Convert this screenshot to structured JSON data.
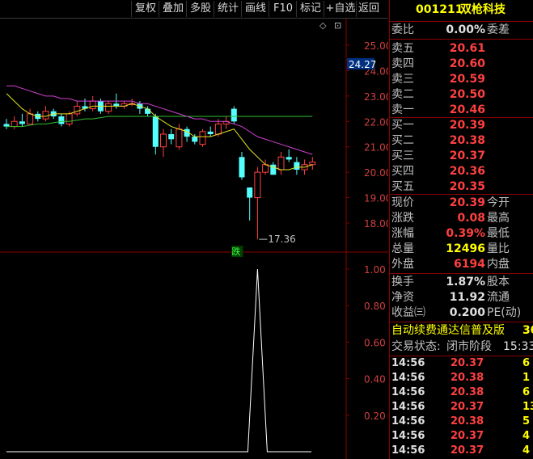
{
  "toolbar": {
    "buttons": [
      "复权",
      "叠加",
      "多股",
      "统计",
      "画线",
      "F10",
      "标记",
      "+自选",
      "返回"
    ]
  },
  "chart": {
    "price_axis_labels": [
      "25.00",
      "24.00",
      "23.00",
      "22.00",
      "21.00",
      "20.00",
      "19.00",
      "18.00"
    ],
    "current_price_tag": "24.27",
    "low_marker": "17.36",
    "drop_marker": "跌",
    "indicator_axis_labels": [
      "1.00",
      "0.80",
      "0.60",
      "0.40",
      "0.20"
    ],
    "settings_glyph": "◇",
    "collapse_glyph": "⊡"
  },
  "chart_data": {
    "type": "candlestick",
    "price_ylim": [
      17.0,
      25.5
    ],
    "candles": [
      {
        "o": 21.9,
        "h": 22.1,
        "l": 21.7,
        "c": 21.8,
        "up": false
      },
      {
        "o": 21.8,
        "h": 22.2,
        "l": 21.7,
        "c": 22.0,
        "up": true
      },
      {
        "o": 22.0,
        "h": 22.3,
        "l": 21.8,
        "c": 21.9,
        "up": false
      },
      {
        "o": 21.9,
        "h": 22.5,
        "l": 21.9,
        "c": 22.3,
        "up": true
      },
      {
        "o": 22.3,
        "h": 22.4,
        "l": 22.0,
        "c": 22.1,
        "up": false
      },
      {
        "o": 22.1,
        "h": 22.6,
        "l": 22.0,
        "c": 22.4,
        "up": true
      },
      {
        "o": 22.4,
        "h": 22.5,
        "l": 22.1,
        "c": 22.2,
        "up": false
      },
      {
        "o": 22.2,
        "h": 22.3,
        "l": 21.8,
        "c": 21.9,
        "up": false
      },
      {
        "o": 21.9,
        "h": 22.4,
        "l": 21.8,
        "c": 22.3,
        "up": true
      },
      {
        "o": 22.3,
        "h": 22.8,
        "l": 22.2,
        "c": 22.6,
        "up": true
      },
      {
        "o": 22.6,
        "h": 22.9,
        "l": 22.4,
        "c": 22.5,
        "up": false
      },
      {
        "o": 22.5,
        "h": 23.0,
        "l": 22.4,
        "c": 22.8,
        "up": true
      },
      {
        "o": 22.8,
        "h": 22.9,
        "l": 22.3,
        "c": 22.4,
        "up": false
      },
      {
        "o": 22.4,
        "h": 22.8,
        "l": 22.3,
        "c": 22.7,
        "up": true
      },
      {
        "o": 22.7,
        "h": 23.1,
        "l": 22.5,
        "c": 22.6,
        "up": false
      },
      {
        "o": 22.6,
        "h": 22.8,
        "l": 22.5,
        "c": 22.7,
        "up": true
      },
      {
        "o": 22.7,
        "h": 22.9,
        "l": 22.6,
        "c": 22.7,
        "up": true
      },
      {
        "o": 22.7,
        "h": 22.8,
        "l": 22.3,
        "c": 22.5,
        "up": false
      },
      {
        "o": 22.5,
        "h": 22.6,
        "l": 22.2,
        "c": 22.3,
        "up": false
      },
      {
        "o": 22.2,
        "h": 22.3,
        "l": 20.7,
        "c": 21.0,
        "up": false
      },
      {
        "o": 21.0,
        "h": 21.7,
        "l": 20.6,
        "c": 21.5,
        "up": true
      },
      {
        "o": 21.5,
        "h": 21.7,
        "l": 21.1,
        "c": 21.3,
        "up": false
      },
      {
        "o": 21.0,
        "h": 21.9,
        "l": 20.9,
        "c": 21.7,
        "up": true
      },
      {
        "o": 21.7,
        "h": 21.8,
        "l": 21.2,
        "c": 21.4,
        "up": false
      },
      {
        "o": 21.4,
        "h": 21.5,
        "l": 21.1,
        "c": 21.2,
        "up": false
      },
      {
        "o": 21.1,
        "h": 21.7,
        "l": 21.0,
        "c": 21.6,
        "up": true
      },
      {
        "o": 21.6,
        "h": 21.8,
        "l": 21.4,
        "c": 21.5,
        "up": false
      },
      {
        "o": 21.5,
        "h": 22.1,
        "l": 21.4,
        "c": 21.9,
        "up": true
      },
      {
        "o": 21.9,
        "h": 22.2,
        "l": 21.7,
        "c": 22.0,
        "up": true
      },
      {
        "o": 22.5,
        "h": 22.6,
        "l": 21.9,
        "c": 22.0,
        "up": false
      },
      {
        "o": 20.6,
        "h": 20.8,
        "l": 19.7,
        "c": 19.8,
        "up": false
      },
      {
        "o": 19.4,
        "h": 19.4,
        "l": 18.1,
        "c": 19.0,
        "up": false
      },
      {
        "o": 19.0,
        "h": 20.2,
        "l": 17.36,
        "c": 20.0,
        "up": true
      },
      {
        "o": 20.0,
        "h": 20.5,
        "l": 19.9,
        "c": 20.3,
        "up": true
      },
      {
        "o": 20.3,
        "h": 20.4,
        "l": 19.9,
        "c": 19.9,
        "up": false
      },
      {
        "o": 20.1,
        "h": 20.8,
        "l": 19.9,
        "c": 20.6,
        "up": true
      },
      {
        "o": 20.6,
        "h": 20.9,
        "l": 20.4,
        "c": 20.5,
        "up": false
      },
      {
        "o": 20.4,
        "h": 20.6,
        "l": 19.9,
        "c": 20.1,
        "up": false
      },
      {
        "o": 20.1,
        "h": 20.5,
        "l": 19.9,
        "c": 20.3,
        "up": true
      },
      {
        "o": 20.3,
        "h": 20.6,
        "l": 20.1,
        "c": 20.4,
        "up": true
      }
    ],
    "ma_yellow": [
      23.1,
      22.8,
      22.5,
      22.3,
      22.2,
      22.2,
      22.3,
      22.3,
      22.3,
      22.4,
      22.5,
      22.6,
      22.6,
      22.6,
      22.6,
      22.6,
      22.7,
      22.6,
      22.5,
      22.2,
      22.0,
      21.8,
      21.7,
      21.6,
      21.4,
      21.4,
      21.4,
      21.5,
      21.6,
      21.7,
      21.3,
      20.9,
      20.6,
      20.3,
      20.2,
      20.1,
      20.1,
      20.2,
      20.2,
      20.3
    ],
    "ma_magenta": [
      23.4,
      23.4,
      23.3,
      23.2,
      23.1,
      23.0,
      23.0,
      22.9,
      22.9,
      22.8,
      22.8,
      22.8,
      22.8,
      22.8,
      22.8,
      22.8,
      22.8,
      22.7,
      22.7,
      22.6,
      22.5,
      22.4,
      22.3,
      22.2,
      22.1,
      22.1,
      22.0,
      22.0,
      22.0,
      21.9,
      21.8,
      21.6,
      21.4,
      21.3,
      21.2,
      21.1,
      21.0,
      20.9,
      20.8,
      20.7
    ],
    "ma_green": [
      21.8,
      21.8,
      21.8,
      21.85,
      21.9,
      21.9,
      21.95,
      22.0,
      22.0,
      22.05,
      22.1,
      22.1,
      22.15,
      22.2,
      22.2,
      22.2,
      22.2,
      22.2,
      22.2,
      22.2,
      22.2,
      22.2,
      22.2,
      22.2,
      22.2,
      22.2,
      22.2,
      22.2,
      22.2,
      22.2,
      22.2,
      22.2,
      22.2,
      22.2,
      22.2,
      22.2,
      22.2,
      22.2,
      22.2,
      22.2
    ],
    "indicator": {
      "ylim": [
        0,
        1.1
      ],
      "spike_index": 32,
      "spike_value": 1.0
    }
  },
  "panel": {
    "stock_code": "001211",
    "stock_name": "双枪科技",
    "ratio_label": "委比",
    "ratio_value": "0.00%",
    "diff_label": "委差",
    "asks": [
      {
        "label": "卖五",
        "price": "20.61"
      },
      {
        "label": "卖四",
        "price": "20.60"
      },
      {
        "label": "卖三",
        "price": "20.59"
      },
      {
        "label": "卖二",
        "price": "20.50"
      },
      {
        "label": "卖一",
        "price": "20.46"
      }
    ],
    "bids": [
      {
        "label": "买一",
        "price": "20.39"
      },
      {
        "label": "买二",
        "price": "20.38"
      },
      {
        "label": "买三",
        "price": "20.37"
      },
      {
        "label": "买四",
        "price": "20.36"
      },
      {
        "label": "买五",
        "price": "20.35"
      }
    ],
    "stats": [
      {
        "label": "现价",
        "value": "20.39",
        "label2": "今开",
        "color": "red"
      },
      {
        "label": "涨跌",
        "value": "0.08",
        "label2": "最高",
        "color": "red"
      },
      {
        "label": "涨幅",
        "value": "0.39%",
        "label2": "最低",
        "color": "red"
      },
      {
        "label": "总量",
        "value": "12496",
        "label2": "量比",
        "color": "yellow"
      },
      {
        "label": "外盘",
        "value": "6194",
        "label2": "内盘",
        "color": "red"
      }
    ],
    "fund": [
      {
        "label": "换手",
        "value": "1.87%",
        "label2": "股本"
      },
      {
        "label": "净资",
        "value": "11.92",
        "label2": "流通"
      },
      {
        "label": "收益㈢",
        "value": "0.200",
        "label2": "PE(动)"
      }
    ],
    "ad_text": "自动续费通达信普及版",
    "ad_num": "30",
    "status_label": "交易状态:",
    "status_value": "闭市阶段",
    "status_time": "15:33",
    "trades": [
      {
        "time": "14:56",
        "price": "20.37",
        "vol": "6"
      },
      {
        "time": "14:56",
        "price": "20.38",
        "vol": "1"
      },
      {
        "time": "14:56",
        "price": "20.38",
        "vol": "6"
      },
      {
        "time": "14:56",
        "price": "20.37",
        "vol": "13"
      },
      {
        "time": "14:56",
        "price": "20.38",
        "vol": "5"
      },
      {
        "time": "14:56",
        "price": "20.37",
        "vol": "4"
      },
      {
        "time": "14:56",
        "price": "20.37",
        "vol": "4"
      }
    ]
  }
}
